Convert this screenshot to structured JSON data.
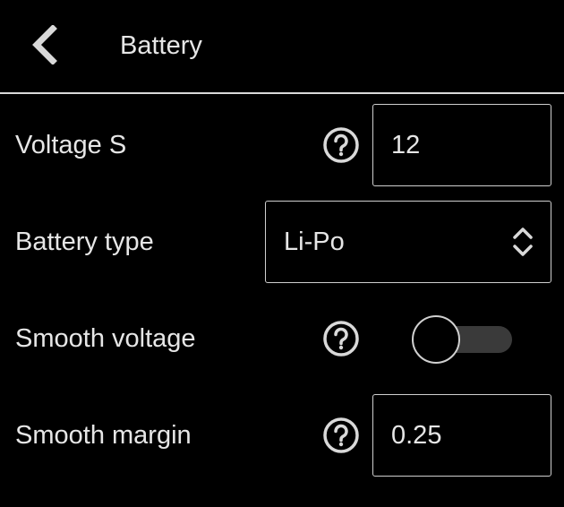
{
  "header": {
    "back_icon": "chevron-left-icon",
    "title": "Battery"
  },
  "colors": {
    "background": "#000000",
    "text": "#e6e6e6",
    "border": "#cfcfcf",
    "toggle_track": "#3a3a3a"
  },
  "settings": {
    "voltage_s": {
      "label": "Voltage S",
      "help_icon": "question-circle-icon",
      "value": "12"
    },
    "battery_type": {
      "label": "Battery type",
      "value": "Li-Po",
      "arrows_icon": "up-down-chevron-icon"
    },
    "smooth_voltage": {
      "label": "Smooth voltage",
      "help_icon": "question-circle-icon",
      "enabled": false
    },
    "smooth_margin": {
      "label": "Smooth margin",
      "help_icon": "question-circle-icon",
      "value": "0.25"
    }
  }
}
